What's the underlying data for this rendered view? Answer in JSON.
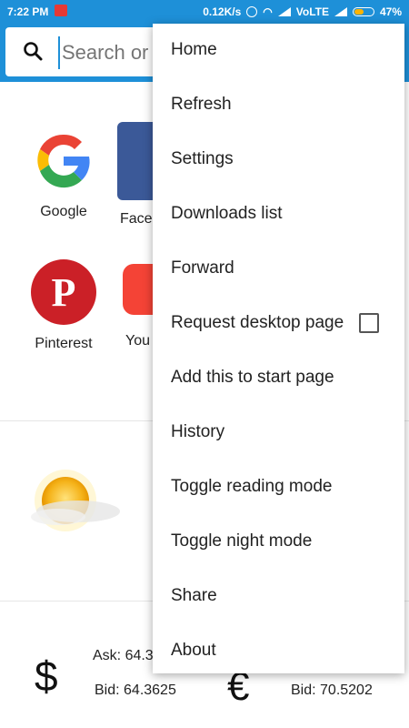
{
  "status_bar": {
    "time": "7:22 PM",
    "network_speed": "0.12K/s",
    "network_type": "VoLTE",
    "battery": "47%",
    "icons": [
      "app-badge-icon",
      "alarm-icon",
      "wifi-icon",
      "signal-icon",
      "signal-icon",
      "battery-icon"
    ]
  },
  "search": {
    "placeholder": "Search or type URL",
    "visible_text": "Search or t"
  },
  "speed_dial": [
    {
      "label": "Google"
    },
    {
      "label": "Face"
    },
    {
      "label": "Pinterest"
    },
    {
      "label": "You"
    }
  ],
  "weather": {
    "icon": "sun-cloud-icon"
  },
  "currency": {
    "ask": "Ask: 64.3",
    "bid_left": "Bid: 64.3625",
    "bid_right": "Bid: 70.5202"
  },
  "menu": {
    "items": [
      {
        "label": "Home"
      },
      {
        "label": "Refresh"
      },
      {
        "label": "Settings"
      },
      {
        "label": "Downloads list"
      },
      {
        "label": "Forward"
      },
      {
        "label": "Request desktop page",
        "checked": false
      },
      {
        "label": "Add this to start page"
      },
      {
        "label": "History"
      },
      {
        "label": "Toggle reading mode"
      },
      {
        "label": "Toggle night mode"
      },
      {
        "label": "Share"
      },
      {
        "label": "About"
      }
    ]
  },
  "colors": {
    "accent": "#1e90d8",
    "pinterest": "#cb2027",
    "facebook": "#3b5998",
    "youtube": "#f44336"
  }
}
